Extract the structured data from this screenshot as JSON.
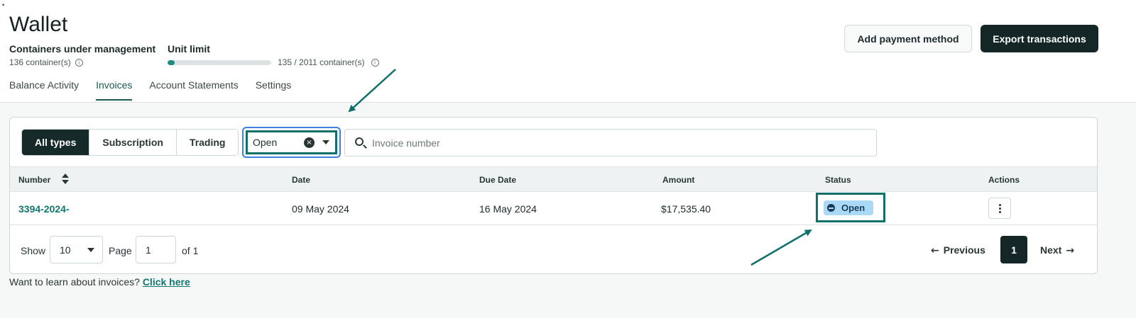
{
  "page": {
    "title": "Wallet",
    "dot": "•"
  },
  "metrics": {
    "containers_label": "Containers under management",
    "containers_value": "136 container(s)",
    "unit_limit_label": "Unit limit",
    "unit_limit_value": "135 / 2011 container(s)",
    "unit_limit_fraction": 0.067
  },
  "header_buttons": {
    "add_payment": "Add payment method",
    "export": "Export transactions"
  },
  "tabs": [
    {
      "label": "Balance Activity",
      "active": false
    },
    {
      "label": "Invoices",
      "active": true
    },
    {
      "label": "Account Statements",
      "active": false
    },
    {
      "label": "Settings",
      "active": false
    }
  ],
  "type_filter": [
    "All types",
    "Subscription",
    "Trading"
  ],
  "status_filter": {
    "value": "Open"
  },
  "search": {
    "placeholder": "Invoice number"
  },
  "table": {
    "columns": [
      "Number",
      "Date",
      "Due Date",
      "Amount",
      "Status",
      "Actions"
    ],
    "rows": [
      {
        "number": "3394-2024-",
        "date": "09 May 2024",
        "due_date": "16 May 2024",
        "amount": "$17,535.40",
        "status": "Open"
      }
    ]
  },
  "pagination": {
    "show_label": "Show",
    "page_size": "10",
    "page_label": "Page",
    "page_value": "1",
    "of_label": "of 1",
    "previous": "Previous",
    "current": "1",
    "next": "Next"
  },
  "help": {
    "text": "Want to learn about invoices?",
    "link": "Click here"
  },
  "colors": {
    "accent": "#12776f",
    "dark": "#142726",
    "focus": "#3e7fe0",
    "badge_bg": "#a9d9f5"
  }
}
